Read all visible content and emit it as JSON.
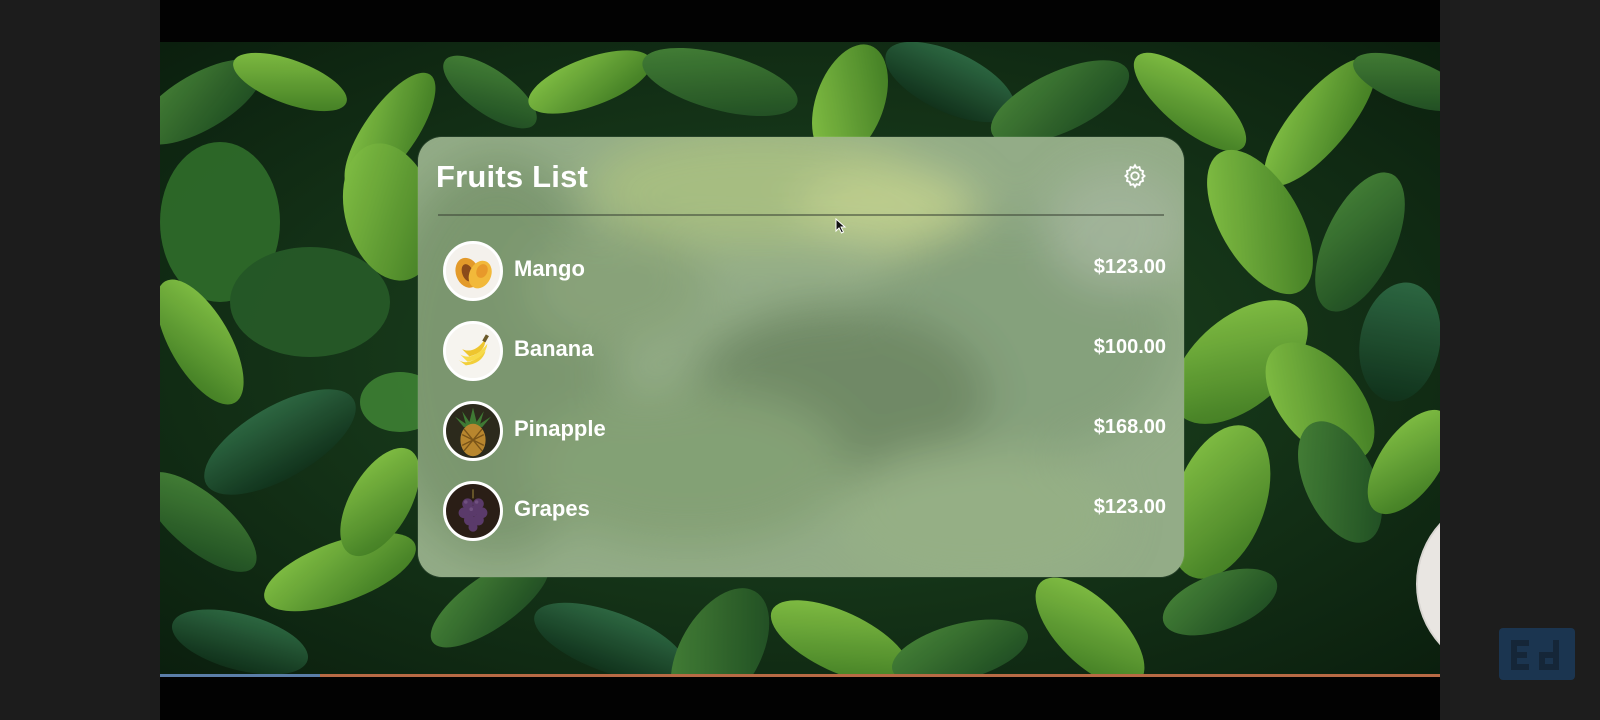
{
  "card": {
    "title": "Fruits List",
    "settings_icon": "gear-icon"
  },
  "fruits": [
    {
      "name": "Mango",
      "price": "$123.00",
      "icon": "mango-image"
    },
    {
      "name": "Banana",
      "price": "$100.00",
      "icon": "banana-image"
    },
    {
      "name": "Pinapple",
      "price": "$168.00",
      "icon": "pineapple-image"
    },
    {
      "name": "Grapes",
      "price": "$123.00",
      "icon": "grapes-image"
    }
  ],
  "colors": {
    "text": "#ffffff",
    "card_glass": "#96af8c",
    "foliage_dark": "#0f2a14",
    "foliage_light": "#6aa83a",
    "progress_played": "#5b7ea8",
    "progress_remaining": "#b86a45"
  },
  "overlays": {
    "webcam": "presenter-webcam",
    "channel_logo": "channel-logo-icon"
  }
}
